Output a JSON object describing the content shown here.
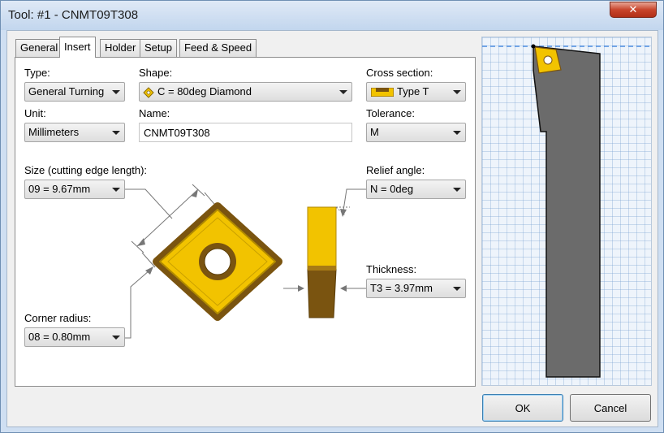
{
  "window": {
    "title": "Tool: #1 - CNMT09T308",
    "close_label": "✕"
  },
  "tabs": [
    {
      "label": "General"
    },
    {
      "label": "Insert",
      "active": true
    },
    {
      "label": "Holder"
    },
    {
      "label": "Setup"
    },
    {
      "label": "Feed & Speed"
    }
  ],
  "form": {
    "type": {
      "label": "Type:",
      "value": "General Turning"
    },
    "shape": {
      "label": "Shape:",
      "value": "C = 80deg Diamond"
    },
    "cross_section": {
      "label": "Cross section:",
      "value": "Type T"
    },
    "unit": {
      "label": "Unit:",
      "value": "Millimeters"
    },
    "name": {
      "label": "Name:",
      "value": "CNMT09T308"
    },
    "tolerance": {
      "label": "Tolerance:",
      "value": "M"
    },
    "size": {
      "label": "Size (cutting edge length):",
      "value": "09 = 9.67mm"
    },
    "relief_angle": {
      "label": "Relief angle:",
      "value": "N = 0deg"
    },
    "thickness": {
      "label": "Thickness:",
      "value": "T3 = 3.97mm"
    },
    "corner_radius": {
      "label": "Corner radius:",
      "value": "08 = 0.80mm"
    }
  },
  "buttons": {
    "ok": "OK",
    "cancel": "Cancel"
  },
  "colors": {
    "insert_gold": "#f2c300",
    "insert_brown": "#7a5410",
    "holder_gray": "#6b6b6b",
    "grid_blue": "#b6cde6",
    "accent_blue": "#3c7fb1"
  },
  "icons": {
    "shape": "diamond-insert-icon",
    "cross_section": "cross-section-t-icon"
  }
}
